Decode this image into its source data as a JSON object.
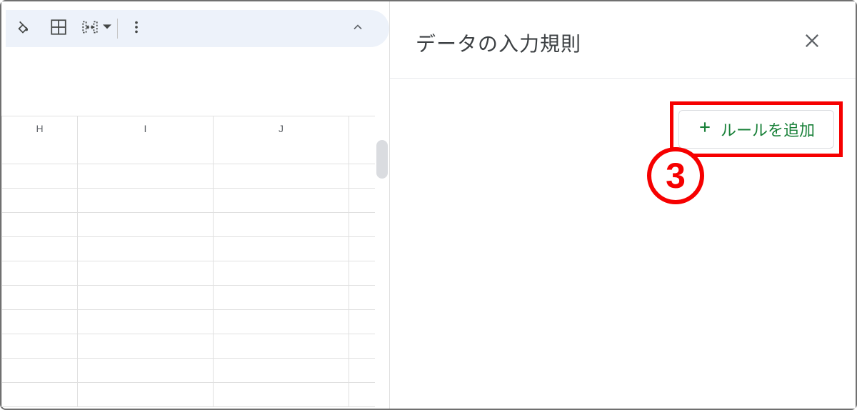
{
  "panel": {
    "title": "データの入力規則",
    "add_rule_label": "ルールを追加"
  },
  "toolbar": {
    "fill_icon": "paint-bucket-icon",
    "borders_icon": "borders-icon",
    "merge_icon": "merge-cells-icon",
    "more_icon": "more-vertical-icon",
    "collapse_icon": "chevron-up-icon"
  },
  "grid": {
    "columns": [
      "H",
      "I",
      "J"
    ],
    "row_count": 11
  },
  "annotation": {
    "step_number": "3"
  }
}
